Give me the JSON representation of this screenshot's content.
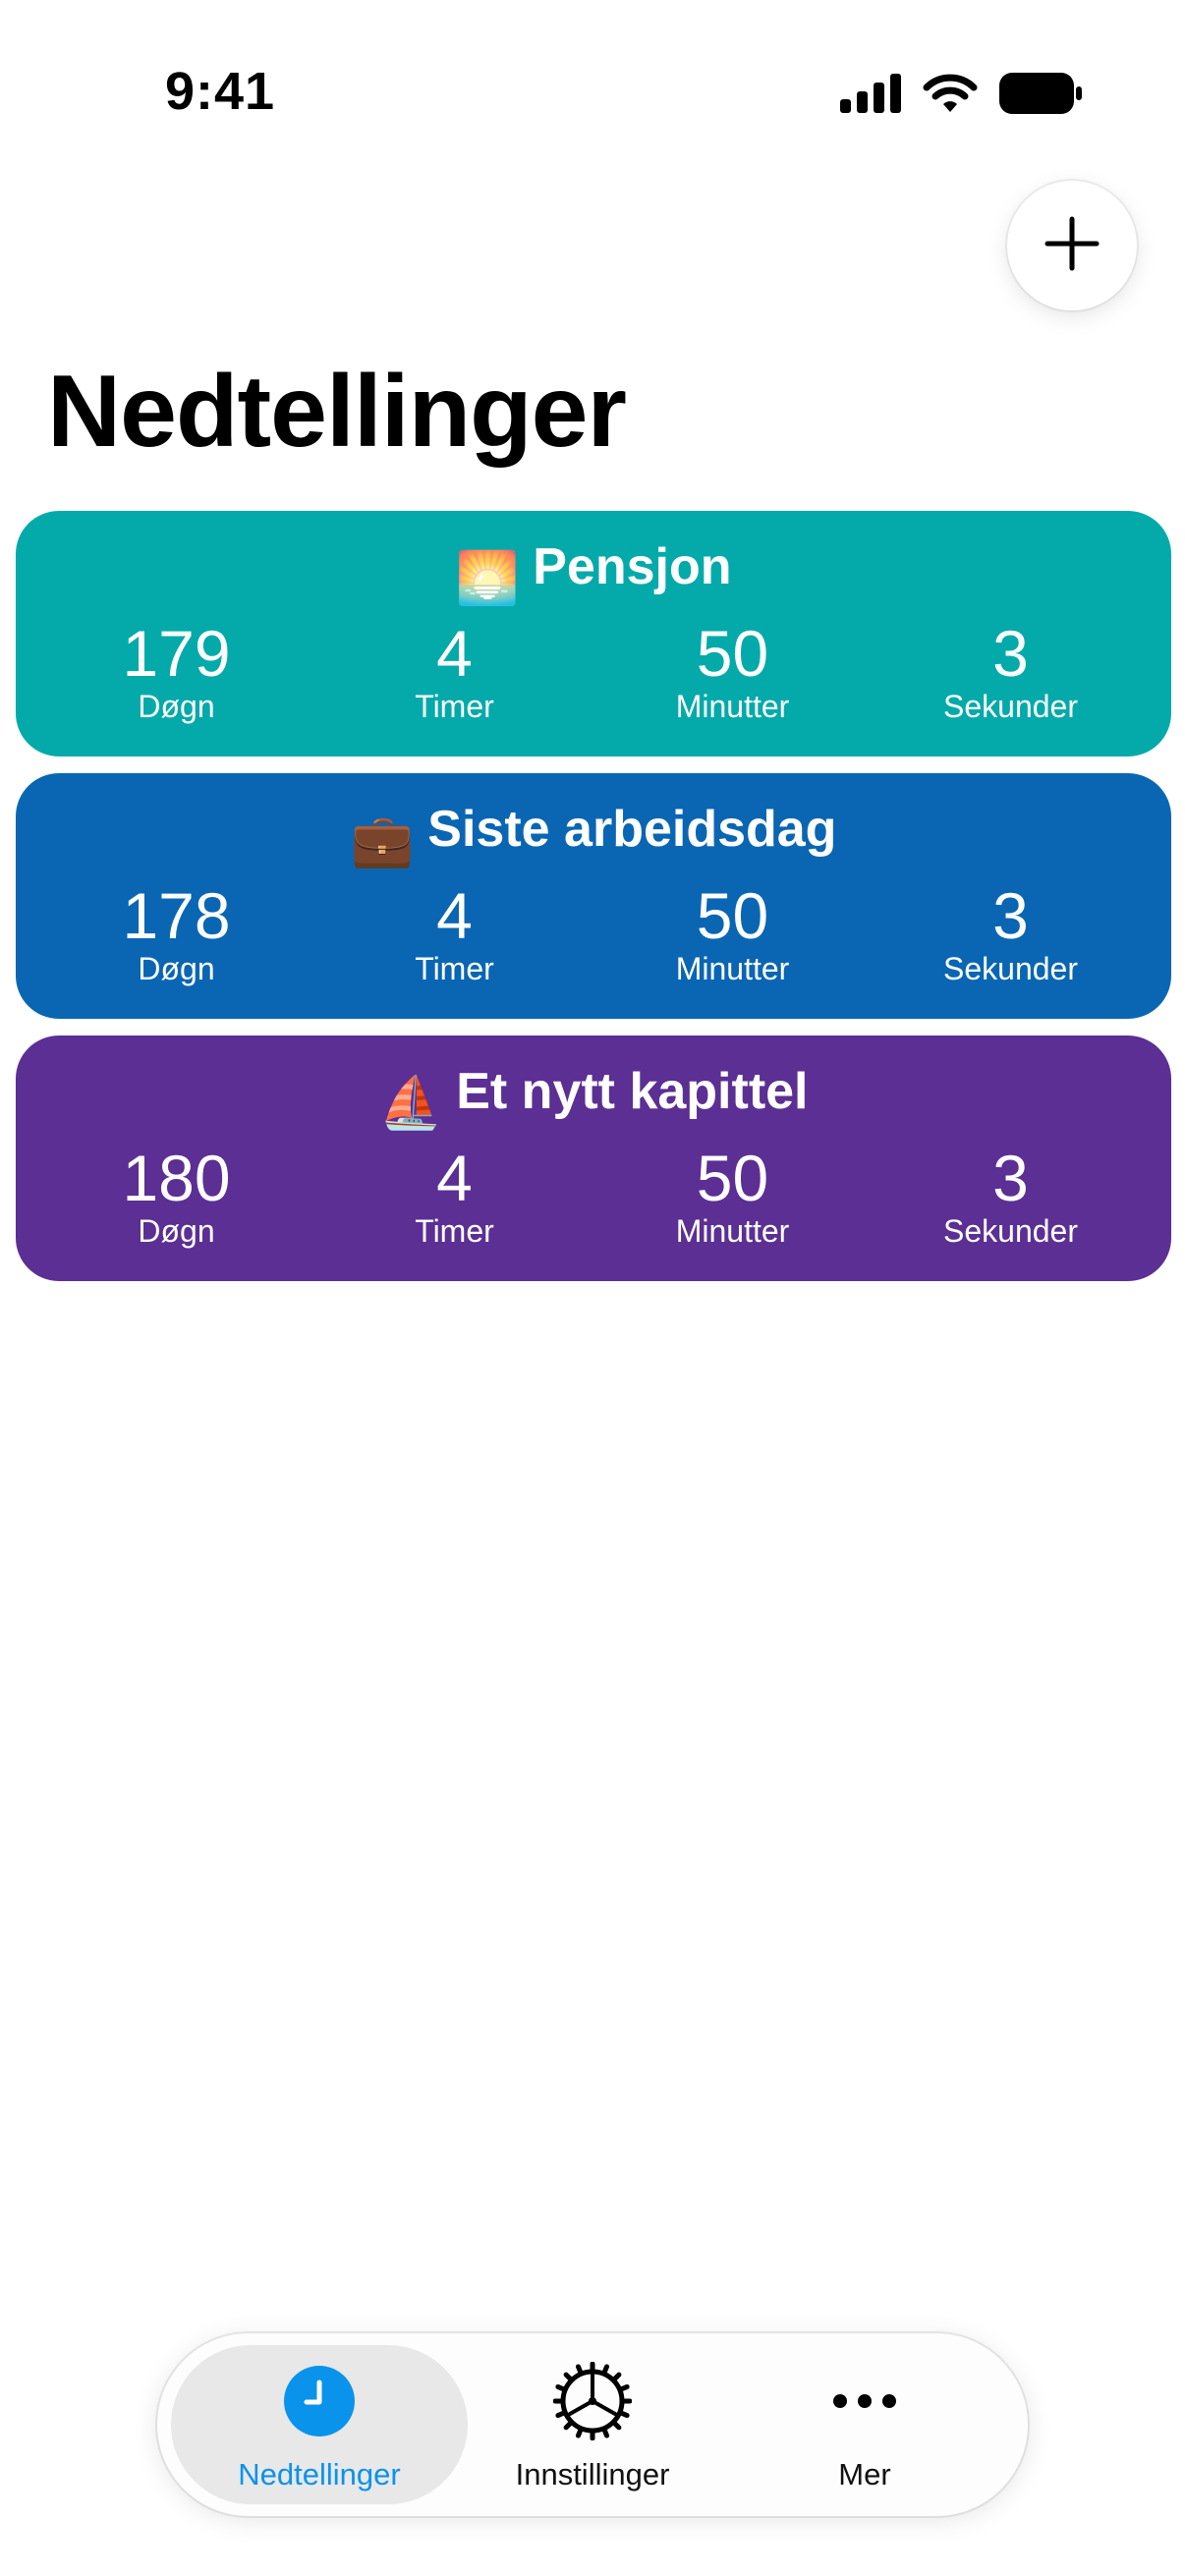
{
  "status_bar": {
    "time": "9:41"
  },
  "header": {
    "title": "Nedtellinger",
    "add_icon": "plus-icon"
  },
  "countdowns": [
    {
      "emoji": "🌅",
      "title": "Pensjon",
      "color": "#04AAAA",
      "units": [
        {
          "value": "179",
          "label": "Døgn"
        },
        {
          "value": "4",
          "label": "Timer"
        },
        {
          "value": "50",
          "label": "Minutter"
        },
        {
          "value": "3",
          "label": "Sekunder"
        }
      ]
    },
    {
      "emoji": "💼",
      "title": "Siste arbeidsdag",
      "color": "#0A66B3",
      "units": [
        {
          "value": "178",
          "label": "Døgn"
        },
        {
          "value": "4",
          "label": "Timer"
        },
        {
          "value": "50",
          "label": "Minutter"
        },
        {
          "value": "3",
          "label": "Sekunder"
        }
      ]
    },
    {
      "emoji": "⛵",
      "title": "Et nytt kapittel",
      "color": "#5B2F93",
      "units": [
        {
          "value": "180",
          "label": "Døgn"
        },
        {
          "value": "4",
          "label": "Timer"
        },
        {
          "value": "50",
          "label": "Minutter"
        },
        {
          "value": "3",
          "label": "Sekunder"
        }
      ]
    }
  ],
  "tab_bar": {
    "tabs": [
      {
        "label": "Nedtellinger",
        "icon": "clock-icon",
        "active": true
      },
      {
        "label": "Innstillinger",
        "icon": "gear-icon",
        "active": false
      },
      {
        "label": "Mer",
        "icon": "more-icon",
        "active": false
      }
    ],
    "active_color": "#0A93EA"
  }
}
